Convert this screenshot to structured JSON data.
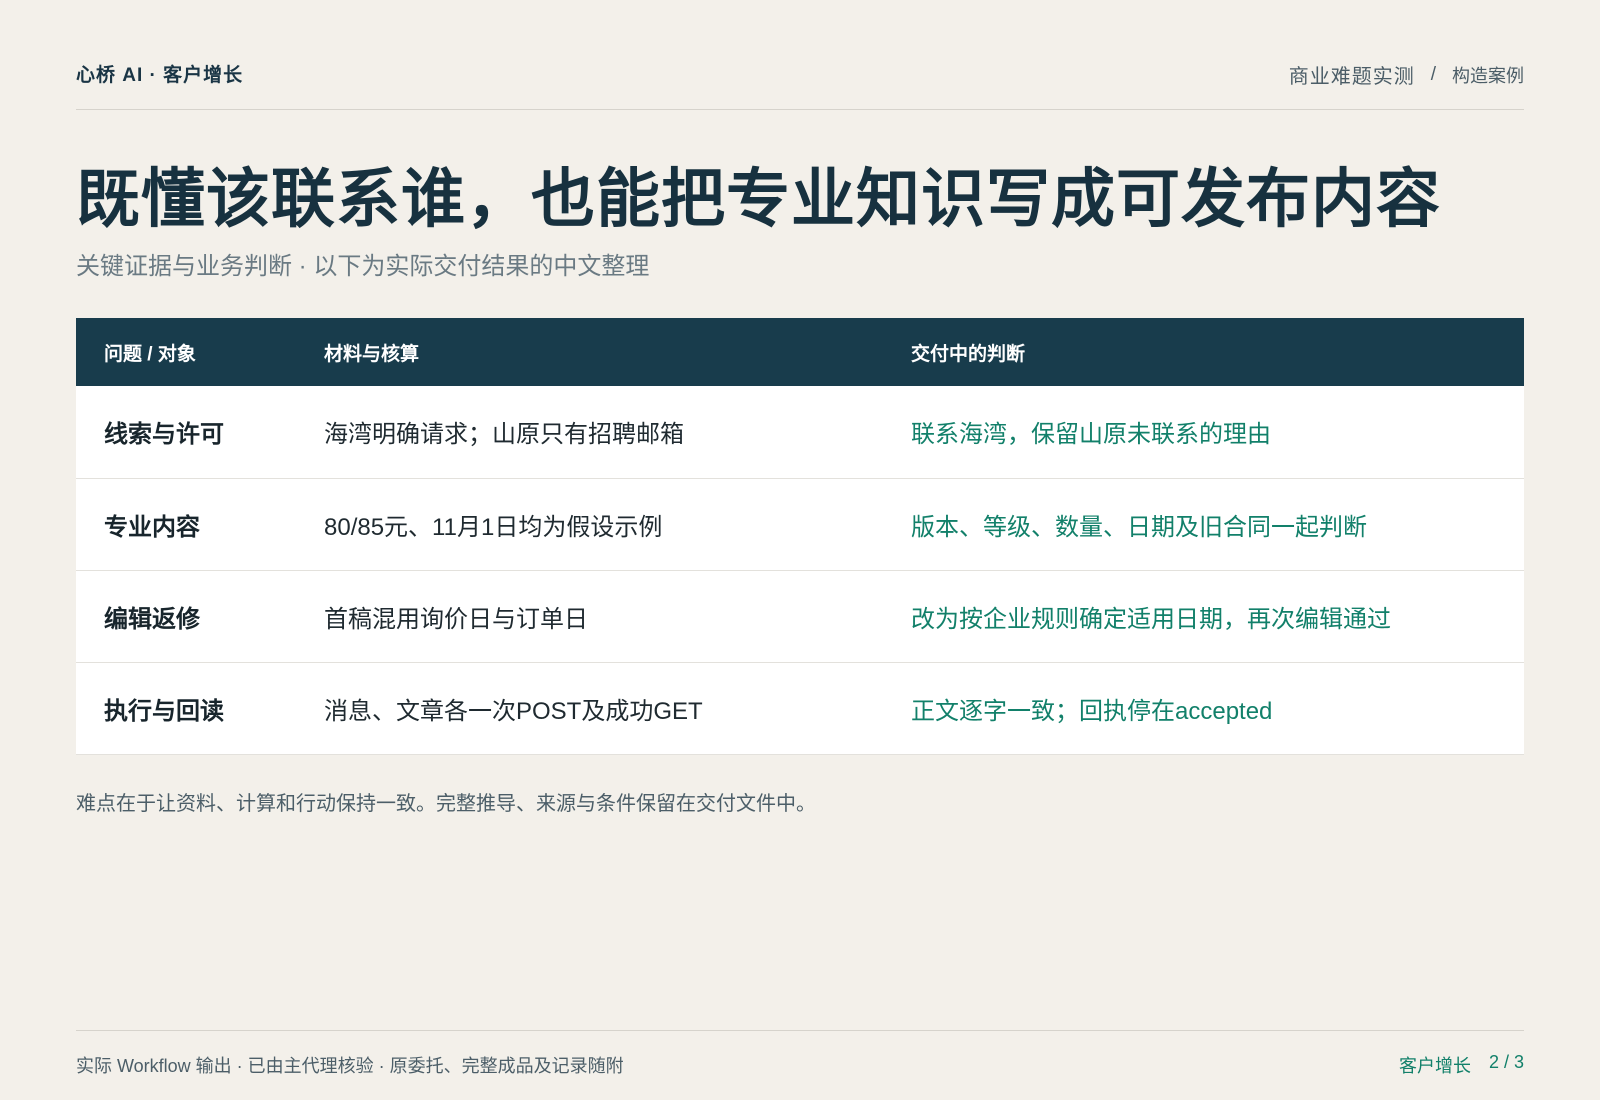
{
  "header": {
    "brand": "心桥 AI · 客户增长",
    "breadcrumb_primary": "商业难题实测",
    "breadcrumb_separator": "/",
    "breadcrumb_secondary": "构造案例"
  },
  "title": "既懂该联系谁，也能把专业知识写成可发布内容",
  "subtitle": "关键证据与业务判断 · 以下为实际交付结果的中文整理",
  "table": {
    "columns": [
      "问题 / 对象",
      "材料与核算",
      "交付中的判断"
    ],
    "rows": [
      {
        "issue": "线索与许可",
        "material": "海湾明确请求；山原只有招聘邮箱",
        "judgement": "联系海湾，保留山原未联系的理由"
      },
      {
        "issue": "专业内容",
        "material": "80/85元、11月1日均为假设示例",
        "judgement": "版本、等级、数量、日期及旧合同一起判断"
      },
      {
        "issue": "编辑返修",
        "material": "首稿混用询价日与订单日",
        "judgement": "改为按企业规则确定适用日期，再次编辑通过"
      },
      {
        "issue": "执行与回读",
        "material": "消息、文章各一次POST及成功GET",
        "judgement": "正文逐字一致；回执停在accepted"
      }
    ]
  },
  "note": "难点在于让资料、计算和行动保持一致。完整推导、来源与条件保留在交付文件中。",
  "footer": {
    "left": "实际 Workflow 输出 · 已由主代理核验 · 原委托、完整成品及记录随附",
    "section": "客户增长",
    "page": "2 / 3"
  },
  "colors": {
    "background": "#f3f0ea",
    "header_row": "#183c4c",
    "accent_green": "#12806a",
    "title": "#17313f"
  }
}
